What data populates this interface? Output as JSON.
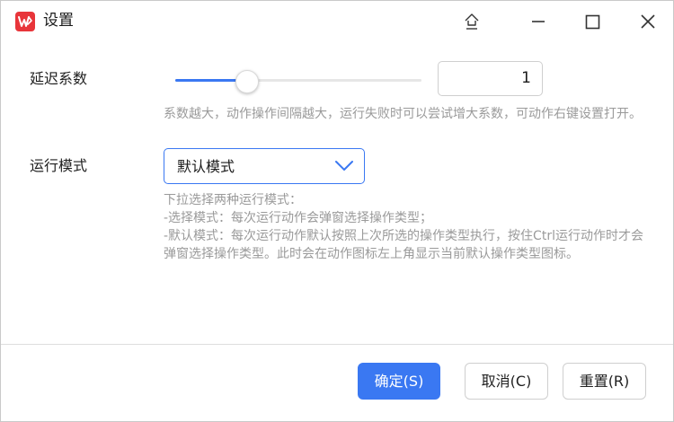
{
  "window": {
    "title": "设置",
    "app_icon": "wps-logo-icon",
    "controls": [
      "pin-icon",
      "minimize-icon",
      "maximize-icon",
      "close-icon"
    ]
  },
  "delay": {
    "label": "延迟系数",
    "slider_fraction": 0.29,
    "value": "1",
    "hint": "系数越大，动作操作间隔越大，运行失败时可以尝试增大系数，可动作右键设置打开。"
  },
  "mode": {
    "label": "运行模式",
    "selected": "默认模式",
    "hint_lines": [
      "下拉选择两种运行模式：",
      "-选择模式：每次运行动作会弹窗选择操作类型；",
      "-默认模式：每次运行动作默认按照上次所选的操作类型执行，按住Ctrl运行动作时才会弹窗选择操作类型。此时会在动作图标左上角显示当前默认操作类型图标。"
    ]
  },
  "buttons": {
    "ok": "确定(S)",
    "cancel": "取消(C)",
    "reset": "重置(R)"
  },
  "colors": {
    "accent": "#3a78f2",
    "brand": "#e8353a",
    "hint": "#9a9a9a"
  }
}
